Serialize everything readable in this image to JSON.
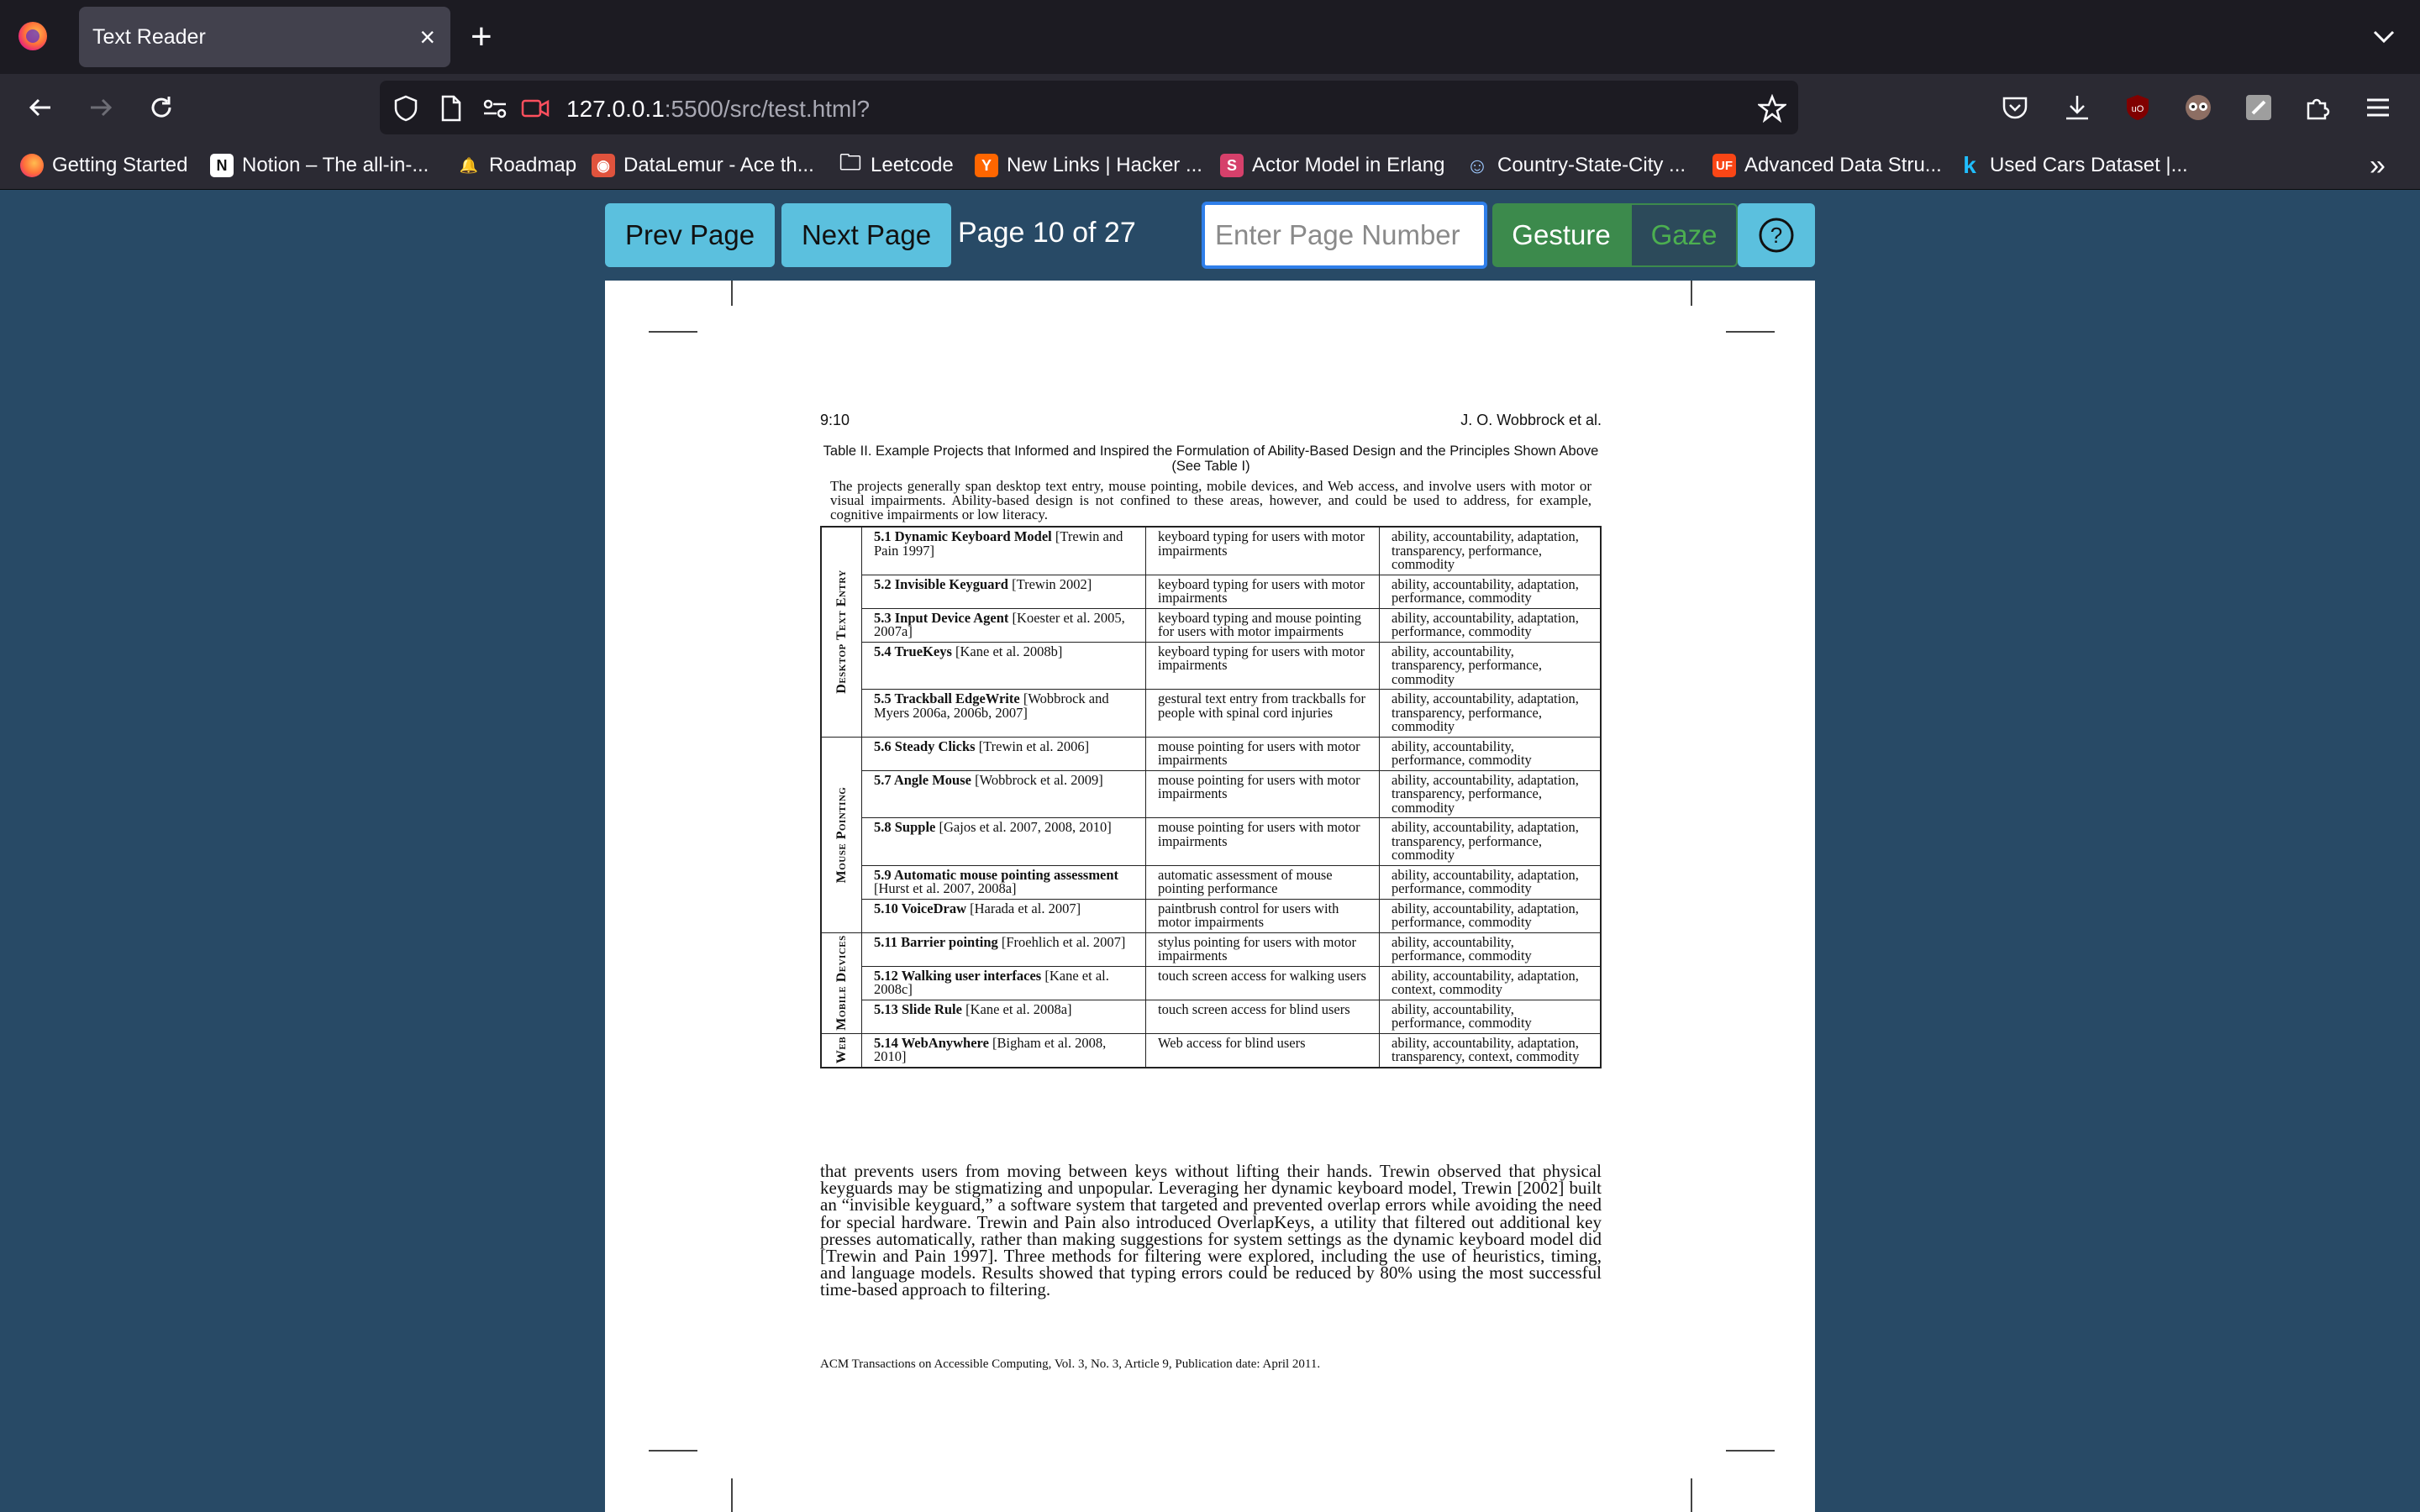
{
  "browser": {
    "tab_title": "Text Reader",
    "tab_close": "×",
    "new_tab": "+",
    "url_host": "127.0.0.1",
    "url_path": ":5500/src/test.html?",
    "bookmarks": [
      {
        "label": "Getting Started",
        "icon": "firefox-icon",
        "color": "#ff7139",
        "glyph": ""
      },
      {
        "label": "Notion – The all-in-...",
        "icon": "notion-icon",
        "color": "#ffffff",
        "glyph": "N"
      },
      {
        "label": "Roadmap",
        "icon": "rocket-icon",
        "color": "#2b2a33",
        "glyph": "🔔"
      },
      {
        "label": "DataLemur - Ace th...",
        "icon": "datalemur-icon",
        "color": "#e0533d",
        "glyph": "◉"
      },
      {
        "label": "Leetcode",
        "icon": "folder-icon",
        "color": "#2b2a33",
        "glyph": "🗀"
      },
      {
        "label": "New Links | Hacker ...",
        "icon": "hackernews-icon",
        "color": "#ff6600",
        "glyph": "Y"
      },
      {
        "label": "Actor Model in Erlang",
        "icon": "scribd-icon",
        "color": "#d6406b",
        "glyph": "S"
      },
      {
        "label": "Country-State-City ...",
        "icon": "globe-icon",
        "color": "#2b2a33",
        "glyph": "☺"
      },
      {
        "label": "Advanced Data Stru...",
        "icon": "uf-icon",
        "color": "#fa4616",
        "glyph": "UF"
      },
      {
        "label": "Used Cars Dataset |...",
        "icon": "kaggle-icon",
        "color": "#2b2a33",
        "glyph": "k"
      }
    ],
    "bookmarks_overflow": "»"
  },
  "toolbar": {
    "prev_label": "Prev Page",
    "next_label": "Next Page",
    "page_indicator": "Page 10 of 27",
    "page_input_placeholder": "Enter Page Number",
    "gesture_label": "Gesture",
    "gaze_label": "Gaze",
    "help_label": "?"
  },
  "document": {
    "page_number": "9:10",
    "author": "J. O. Wobbrock et al.",
    "caption": "Table II. Example Projects that Informed and Inspired the Formulation of Ability-Based Design and the Principles Shown Above (See Table I)",
    "intro": "The projects generally span desktop text entry, mouse pointing, mobile devices, and Web access, and involve users with motor or visual impairments. Ability-based design is not confined to these areas, however, and could be used to address, for example, cognitive impairments or low literacy.",
    "groups": [
      {
        "label": "Desktop Text Entry",
        "rows": [
          {
            "title": "5.1 Dynamic Keyboard Model",
            "ref": "[Trewin and Pain 1997]",
            "desc": "keyboard typing for users with motor impairments",
            "principles": "ability, accountability, adaptation, transparency, performance, commodity"
          },
          {
            "title": "5.2 Invisible Keyguard",
            "ref": "[Trewin 2002]",
            "desc": "keyboard typing for users with motor impairments",
            "principles": "ability, accountability, adaptation, performance, commodity"
          },
          {
            "title": "5.3 Input Device Agent",
            "ref": "[Koester et al. 2005, 2007a]",
            "desc": "keyboard typing and mouse pointing for users with motor impairments",
            "principles": "ability, accountability, adaptation, performance, commodity"
          },
          {
            "title": "5.4 TrueKeys",
            "ref": "[Kane et al. 2008b]",
            "desc": "keyboard typing for users with motor impairments",
            "principles": "ability, accountability, transparency, performance, commodity"
          },
          {
            "title": "5.5 Trackball EdgeWrite",
            "ref": "[Wobbrock and Myers 2006a, 2006b, 2007]",
            "desc": "gestural text entry from trackballs for people with spinal cord injuries",
            "principles": "ability, accountability, adaptation, transparency, performance, commodity"
          }
        ]
      },
      {
        "label": "Mouse Pointing",
        "rows": [
          {
            "title": "5.6 Steady Clicks",
            "ref": "[Trewin et al. 2006]",
            "desc": "mouse pointing for users with motor impairments",
            "principles": "ability, accountability, performance, commodity"
          },
          {
            "title": "5.7 Angle Mouse",
            "ref": "[Wobbrock et al. 2009]",
            "desc": "mouse pointing for users with motor impairments",
            "principles": "ability, accountability, adaptation, transparency, performance, commodity"
          },
          {
            "title": "5.8 Supple",
            "ref": "[Gajos et al. 2007, 2008, 2010]",
            "desc": "mouse pointing for users with motor impairments",
            "principles": "ability, accountability, adaptation, transparency, performance, commodity"
          },
          {
            "title": "5.9 Automatic mouse pointing assessment",
            "ref": "[Hurst et al. 2007, 2008a]",
            "desc": "automatic assessment of mouse pointing performance",
            "principles": "ability, accountability, adaptation, performance, commodity"
          },
          {
            "title": "5.10 VoiceDraw",
            "ref": "[Harada et al. 2007]",
            "desc": "paintbrush control for users with motor impairments",
            "principles": "ability, accountability, adaptation, performance, commodity"
          }
        ]
      },
      {
        "label": "Mobile Devices",
        "rows": [
          {
            "title": "5.11 Barrier pointing",
            "ref": "[Froehlich et al. 2007]",
            "desc": "stylus pointing for users with motor impairments",
            "principles": "ability, accountability, performance, commodity"
          },
          {
            "title": "5.12 Walking user interfaces",
            "ref": "[Kane et al. 2008c]",
            "desc": "touch screen access for walking users",
            "principles": "ability, accountability, adaptation, context, commodity"
          },
          {
            "title": "5.13 Slide Rule",
            "ref": "[Kane et al. 2008a]",
            "desc": "touch screen access for blind users",
            "principles": "ability, accountability, performance, commodity"
          }
        ]
      },
      {
        "label": "Web",
        "rows": [
          {
            "title": "5.14 WebAnywhere",
            "ref": "[Bigham et al. 2008, 2010]",
            "desc": "Web access for blind users",
            "principles": "ability, accountability, adaptation, transparency, context, commodity"
          }
        ]
      }
    ],
    "body": "that prevents users from moving between keys without lifting their hands. Trewin observed that physical keyguards may be stigmatizing and unpopular. Leveraging her dynamic keyboard model, Trewin [2002] built an “invisible keyguard,” a software system that targeted and prevented overlap errors while avoiding the need for special hardware. Trewin and Pain also introduced OverlapKeys, a utility that filtered out additional key presses automatically, rather than making suggestions for system settings as the dynamic keyboard model did [Trewin and Pain 1997]. Three methods for filtering were explored, including the use of heuristics, timing, and language models. Results showed that typing errors could be reduced by 80% using the most successful time-based approach to filtering.",
    "footer": "ACM Transactions on Accessible Computing, Vol. 3, No. 3, Article 9, Publication date: April 2011."
  }
}
